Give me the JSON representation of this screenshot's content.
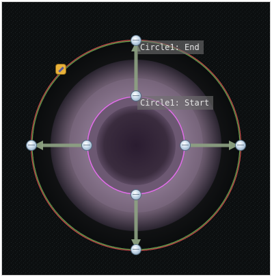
{
  "tool": {
    "end_label": "Circle1: End",
    "start_label": "Circle1: Start"
  },
  "colors": {
    "background": "#0a0c0d",
    "inner_circle": "#e070e8",
    "outer_circle_red": "#c94a4a",
    "outer_circle_green": "#6aa84f",
    "arrow": "#8ea383",
    "handle": "#c7d9ea",
    "edit_icon": "#e8b23a"
  },
  "icons": {
    "handle": "roi-handle-icon",
    "edit": "edit-pencil-icon"
  }
}
